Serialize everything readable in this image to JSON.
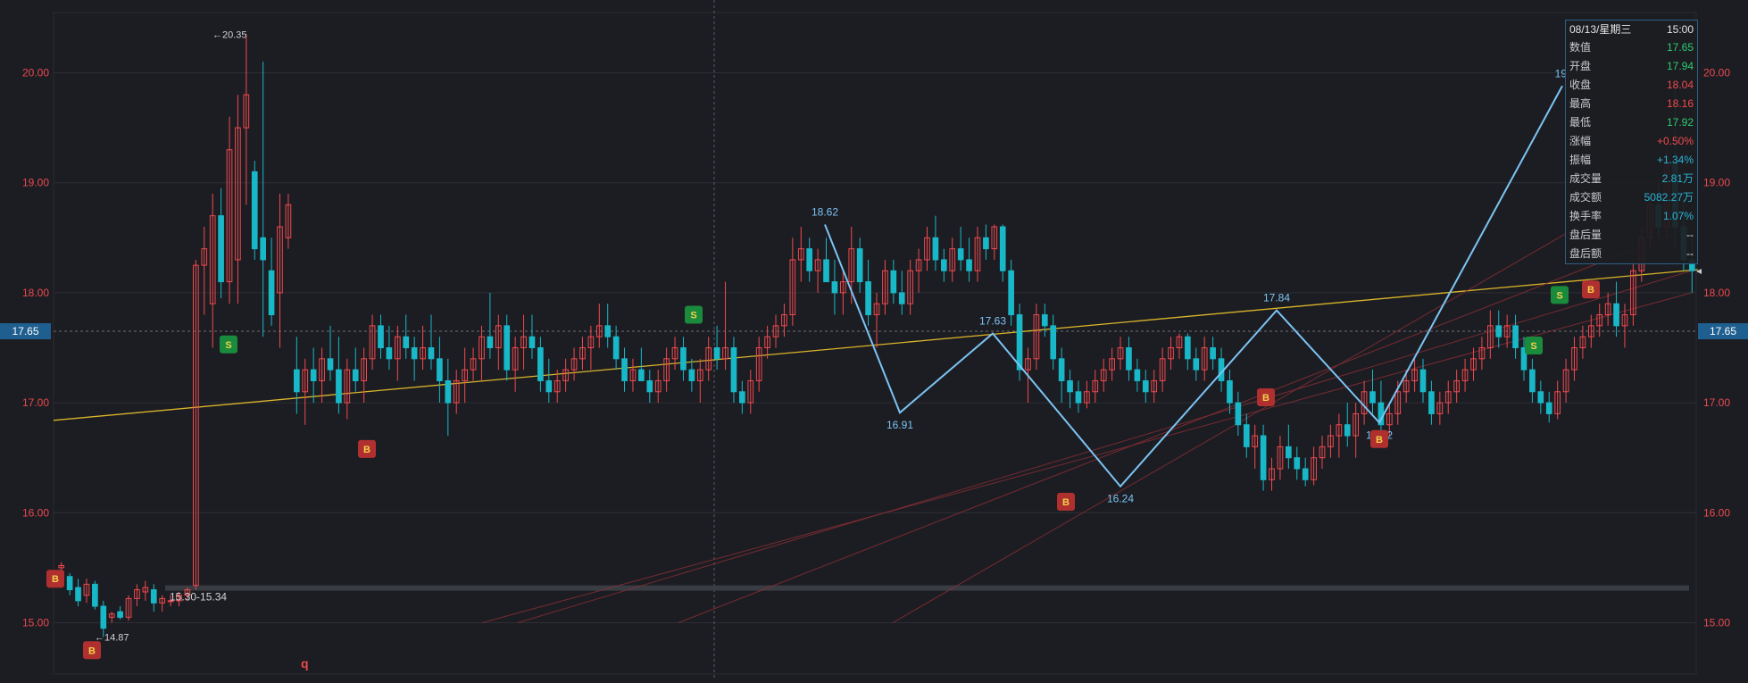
{
  "chart_data": {
    "type": "candlestick",
    "ylim": [
      14.9,
      20.55
    ],
    "y_ticks": [
      "15.00",
      "16.00",
      "17.00",
      "18.00",
      "19.00",
      "20.00"
    ],
    "current_price_label": "17.65",
    "candles": [
      [
        15.5,
        15.55,
        15.45,
        15.52
      ],
      [
        15.42,
        15.45,
        15.25,
        15.3
      ],
      [
        15.32,
        15.4,
        15.15,
        15.2
      ],
      [
        15.25,
        15.4,
        15.18,
        15.35
      ],
      [
        15.35,
        15.38,
        15.12,
        15.15
      ],
      [
        15.15,
        15.2,
        14.87,
        14.95
      ],
      [
        15.05,
        15.1,
        15.0,
        15.08
      ],
      [
        15.1,
        15.15,
        15.03,
        15.05
      ],
      [
        15.05,
        15.25,
        15.02,
        15.22
      ],
      [
        15.22,
        15.35,
        15.15,
        15.3
      ],
      [
        15.28,
        15.38,
        15.2,
        15.32
      ],
      [
        15.3,
        15.35,
        15.1,
        15.18
      ],
      [
        15.18,
        15.25,
        15.1,
        15.22
      ],
      [
        15.2,
        15.25,
        15.15,
        15.2
      ],
      [
        15.2,
        15.28,
        15.15,
        15.25
      ],
      [
        15.25,
        15.32,
        15.2,
        15.3
      ],
      [
        15.34,
        18.3,
        15.3,
        18.25
      ],
      [
        18.25,
        18.6,
        17.8,
        18.4
      ],
      [
        17.9,
        18.9,
        17.5,
        18.7
      ],
      [
        18.7,
        18.95,
        17.95,
        18.1
      ],
      [
        18.1,
        19.6,
        17.9,
        19.3
      ],
      [
        18.3,
        19.8,
        17.9,
        19.5
      ],
      [
        19.5,
        20.35,
        18.8,
        19.8
      ],
      [
        19.1,
        19.2,
        18.3,
        18.4
      ],
      [
        18.5,
        20.1,
        17.6,
        18.3
      ],
      [
        18.2,
        18.5,
        17.7,
        17.8
      ],
      [
        18.0,
        18.9,
        17.5,
        18.6
      ],
      [
        18.5,
        18.9,
        18.4,
        18.8
      ],
      [
        17.3,
        17.6,
        16.9,
        17.1
      ],
      [
        17.1,
        17.4,
        16.8,
        17.3
      ],
      [
        17.3,
        17.5,
        17.0,
        17.2
      ],
      [
        17.2,
        17.5,
        17.0,
        17.4
      ],
      [
        17.4,
        17.7,
        17.2,
        17.3
      ],
      [
        17.3,
        17.6,
        16.9,
        17.0
      ],
      [
        17.0,
        17.4,
        16.85,
        17.3
      ],
      [
        17.3,
        17.5,
        17.1,
        17.2
      ],
      [
        17.2,
        17.5,
        17.0,
        17.4
      ],
      [
        17.4,
        17.8,
        17.3,
        17.7
      ],
      [
        17.7,
        17.8,
        17.4,
        17.5
      ],
      [
        17.5,
        17.7,
        17.3,
        17.4
      ],
      [
        17.4,
        17.7,
        17.2,
        17.6
      ],
      [
        17.6,
        17.8,
        17.4,
        17.5
      ],
      [
        17.5,
        17.6,
        17.2,
        17.4
      ],
      [
        17.4,
        17.7,
        17.3,
        17.5
      ],
      [
        17.5,
        17.8,
        17.3,
        17.4
      ],
      [
        17.4,
        17.6,
        17.0,
        17.2
      ],
      [
        17.2,
        17.4,
        16.7,
        17.0
      ],
      [
        17.0,
        17.3,
        16.9,
        17.2
      ],
      [
        17.2,
        17.5,
        17.0,
        17.3
      ],
      [
        17.3,
        17.5,
        17.2,
        17.4
      ],
      [
        17.4,
        17.7,
        17.2,
        17.6
      ],
      [
        17.6,
        18.0,
        17.4,
        17.5
      ],
      [
        17.5,
        17.8,
        17.3,
        17.7
      ],
      [
        17.7,
        17.8,
        17.2,
        17.3
      ],
      [
        17.3,
        17.6,
        17.1,
        17.5
      ],
      [
        17.5,
        17.8,
        17.3,
        17.6
      ],
      [
        17.6,
        17.8,
        17.4,
        17.5
      ],
      [
        17.5,
        17.6,
        17.1,
        17.2
      ],
      [
        17.2,
        17.4,
        17.0,
        17.1
      ],
      [
        17.1,
        17.3,
        17.0,
        17.2
      ],
      [
        17.2,
        17.4,
        17.1,
        17.3
      ],
      [
        17.3,
        17.5,
        17.2,
        17.4
      ],
      [
        17.4,
        17.6,
        17.3,
        17.5
      ],
      [
        17.5,
        17.7,
        17.3,
        17.6
      ],
      [
        17.6,
        17.9,
        17.5,
        17.7
      ],
      [
        17.7,
        17.9,
        17.5,
        17.6
      ],
      [
        17.6,
        17.7,
        17.3,
        17.4
      ],
      [
        17.4,
        17.5,
        17.1,
        17.2
      ],
      [
        17.2,
        17.4,
        17.1,
        17.3
      ],
      [
        17.3,
        17.5,
        17.2,
        17.2
      ],
      [
        17.2,
        17.3,
        17.0,
        17.1
      ],
      [
        17.1,
        17.3,
        17.0,
        17.2
      ],
      [
        17.2,
        17.5,
        17.1,
        17.4
      ],
      [
        17.4,
        17.6,
        17.3,
        17.5
      ],
      [
        17.5,
        17.6,
        17.2,
        17.3
      ],
      [
        17.3,
        17.4,
        17.1,
        17.2
      ],
      [
        17.2,
        17.4,
        17.0,
        17.3
      ],
      [
        17.3,
        17.6,
        17.2,
        17.5
      ],
      [
        17.5,
        17.7,
        17.3,
        17.4
      ],
      [
        17.4,
        18.1,
        17.3,
        17.5
      ],
      [
        17.5,
        17.6,
        17.0,
        17.1
      ],
      [
        17.1,
        17.2,
        16.9,
        17.0
      ],
      [
        17.0,
        17.3,
        16.9,
        17.2
      ],
      [
        17.2,
        17.6,
        17.1,
        17.5
      ],
      [
        17.5,
        17.7,
        17.4,
        17.6
      ],
      [
        17.6,
        17.8,
        17.5,
        17.7
      ],
      [
        17.7,
        17.9,
        17.6,
        17.8
      ],
      [
        17.8,
        18.5,
        17.7,
        18.3
      ],
      [
        18.3,
        18.6,
        18.1,
        18.4
      ],
      [
        18.4,
        18.5,
        18.1,
        18.2
      ],
      [
        18.2,
        18.4,
        18.0,
        18.3
      ],
      [
        18.3,
        18.5,
        18.1,
        18.1
      ],
      [
        18.1,
        18.3,
        17.8,
        18.0
      ],
      [
        18.0,
        18.2,
        17.8,
        18.1
      ],
      [
        18.1,
        18.6,
        17.9,
        18.4
      ],
      [
        18.4,
        18.5,
        18.0,
        18.1
      ],
      [
        18.1,
        18.3,
        17.7,
        17.8
      ],
      [
        17.8,
        18.0,
        17.5,
        17.9
      ],
      [
        17.9,
        18.3,
        17.8,
        18.2
      ],
      [
        18.2,
        18.3,
        17.9,
        18.0
      ],
      [
        18.0,
        18.2,
        17.8,
        17.9
      ],
      [
        17.9,
        18.3,
        17.8,
        18.2
      ],
      [
        18.2,
        18.4,
        18.0,
        18.3
      ],
      [
        18.3,
        18.6,
        18.2,
        18.5
      ],
      [
        18.5,
        18.7,
        18.2,
        18.3
      ],
      [
        18.3,
        18.4,
        18.1,
        18.2
      ],
      [
        18.2,
        18.5,
        18.1,
        18.4
      ],
      [
        18.4,
        18.6,
        18.2,
        18.3
      ],
      [
        18.3,
        18.5,
        18.1,
        18.2
      ],
      [
        18.2,
        18.6,
        18.1,
        18.5
      ],
      [
        18.5,
        18.62,
        18.3,
        18.4
      ],
      [
        18.4,
        18.62,
        18.3,
        18.6
      ],
      [
        18.6,
        18.62,
        18.1,
        18.2
      ],
      [
        18.2,
        18.3,
        17.7,
        17.8
      ],
      [
        17.8,
        17.9,
        17.2,
        17.3
      ],
      [
        17.3,
        17.5,
        17.0,
        17.4
      ],
      [
        17.4,
        17.9,
        17.3,
        17.8
      ],
      [
        17.8,
        17.9,
        17.6,
        17.7
      ],
      [
        17.7,
        17.8,
        17.3,
        17.4
      ],
      [
        17.4,
        17.5,
        17.0,
        17.2
      ],
      [
        17.2,
        17.3,
        16.95,
        17.1
      ],
      [
        17.1,
        17.2,
        16.91,
        17.0
      ],
      [
        17.0,
        17.2,
        16.95,
        17.1
      ],
      [
        17.1,
        17.3,
        17.0,
        17.2
      ],
      [
        17.2,
        17.4,
        17.1,
        17.3
      ],
      [
        17.3,
        17.5,
        17.2,
        17.4
      ],
      [
        17.4,
        17.6,
        17.3,
        17.5
      ],
      [
        17.5,
        17.6,
        17.2,
        17.3
      ],
      [
        17.3,
        17.4,
        17.1,
        17.2
      ],
      [
        17.2,
        17.3,
        17.0,
        17.1
      ],
      [
        17.1,
        17.3,
        17.0,
        17.2
      ],
      [
        17.2,
        17.5,
        17.1,
        17.4
      ],
      [
        17.4,
        17.6,
        17.3,
        17.5
      ],
      [
        17.5,
        17.63,
        17.4,
        17.6
      ],
      [
        17.6,
        17.63,
        17.3,
        17.4
      ],
      [
        17.4,
        17.5,
        17.2,
        17.3
      ],
      [
        17.3,
        17.6,
        17.2,
        17.5
      ],
      [
        17.5,
        17.6,
        17.3,
        17.4
      ],
      [
        17.4,
        17.5,
        17.1,
        17.2
      ],
      [
        17.2,
        17.3,
        16.9,
        17.0
      ],
      [
        17.0,
        17.1,
        16.7,
        16.8
      ],
      [
        16.8,
        16.9,
        16.5,
        16.6
      ],
      [
        16.6,
        16.8,
        16.4,
        16.7
      ],
      [
        16.7,
        16.8,
        16.2,
        16.3
      ],
      [
        16.3,
        16.5,
        16.2,
        16.4
      ],
      [
        16.4,
        16.7,
        16.3,
        16.6
      ],
      [
        16.6,
        16.8,
        16.4,
        16.5
      ],
      [
        16.5,
        16.6,
        16.3,
        16.4
      ],
      [
        16.4,
        16.5,
        16.24,
        16.3
      ],
      [
        16.3,
        16.6,
        16.25,
        16.5
      ],
      [
        16.5,
        16.7,
        16.4,
        16.6
      ],
      [
        16.6,
        16.8,
        16.5,
        16.7
      ],
      [
        16.7,
        16.9,
        16.5,
        16.8
      ],
      [
        16.8,
        17.0,
        16.6,
        16.7
      ],
      [
        16.7,
        17.0,
        16.5,
        16.9
      ],
      [
        16.9,
        17.2,
        16.8,
        17.1
      ],
      [
        17.1,
        17.3,
        16.9,
        17.0
      ],
      [
        17.0,
        17.2,
        16.6,
        16.8
      ],
      [
        16.8,
        17.0,
        16.7,
        16.9
      ],
      [
        16.9,
        17.2,
        16.8,
        17.1
      ],
      [
        17.1,
        17.3,
        17.0,
        17.2
      ],
      [
        17.2,
        17.4,
        17.1,
        17.3
      ],
      [
        17.3,
        17.4,
        17.0,
        17.1
      ],
      [
        17.1,
        17.2,
        16.8,
        16.9
      ],
      [
        16.9,
        17.1,
        16.8,
        17.0
      ],
      [
        17.0,
        17.2,
        16.9,
        17.1
      ],
      [
        17.1,
        17.3,
        17.0,
        17.2
      ],
      [
        17.2,
        17.4,
        17.1,
        17.3
      ],
      [
        17.3,
        17.5,
        17.2,
        17.4
      ],
      [
        17.4,
        17.6,
        17.3,
        17.5
      ],
      [
        17.5,
        17.84,
        17.4,
        17.7
      ],
      [
        17.7,
        17.84,
        17.5,
        17.6
      ],
      [
        17.6,
        17.8,
        17.5,
        17.7
      ],
      [
        17.7,
        17.8,
        17.4,
        17.5
      ],
      [
        17.5,
        17.6,
        17.2,
        17.3
      ],
      [
        17.3,
        17.4,
        17.0,
        17.1
      ],
      [
        17.1,
        17.2,
        16.9,
        17.0
      ],
      [
        17.0,
        17.1,
        16.82,
        16.9
      ],
      [
        16.9,
        17.2,
        16.85,
        17.1
      ],
      [
        17.1,
        17.4,
        17.0,
        17.3
      ],
      [
        17.3,
        17.6,
        17.2,
        17.5
      ],
      [
        17.5,
        17.7,
        17.4,
        17.6
      ],
      [
        17.6,
        17.8,
        17.5,
        17.7
      ],
      [
        17.7,
        17.9,
        17.6,
        17.8
      ],
      [
        17.8,
        18.0,
        17.7,
        17.9
      ],
      [
        17.9,
        18.1,
        17.6,
        17.7
      ],
      [
        17.7,
        17.9,
        17.5,
        17.8
      ],
      [
        17.8,
        18.3,
        17.7,
        18.2
      ],
      [
        18.2,
        18.6,
        18.1,
        18.5
      ],
      [
        18.5,
        18.9,
        18.4,
        18.8
      ],
      [
        18.8,
        19.0,
        18.5,
        18.6
      ],
      [
        18.6,
        19.3,
        18.5,
        19.2
      ],
      [
        19.2,
        19.9,
        18.4,
        18.6
      ],
      [
        18.6,
        18.9,
        18.2,
        18.3
      ],
      [
        18.3,
        18.5,
        18.0,
        18.2
      ]
    ],
    "zigzag": [
      {
        "label": "18.62",
        "price": 18.62,
        "pos": "top"
      },
      {
        "label": "16.91",
        "price": 16.91,
        "pos": "bottom"
      },
      {
        "label": "17.63",
        "price": 17.63,
        "pos": "top"
      },
      {
        "label": "16.24",
        "price": 16.24,
        "pos": "bottom"
      },
      {
        "label": "17.84",
        "price": 17.84,
        "pos": "top"
      },
      {
        "label": "16.82",
        "price": 16.82,
        "pos": "bottom"
      },
      {
        "label": "19.",
        "price": 19.88,
        "pos": "top"
      }
    ],
    "annotations": {
      "high": "←20.35",
      "low": "←14.87",
      "range": "15.30-15.34",
      "cursor_marker": "q"
    },
    "signals": [
      {
        "type": "B",
        "price": 15.4
      },
      {
        "type": "B",
        "price": 14.75
      },
      {
        "type": "S",
        "price": 17.53
      },
      {
        "type": "B",
        "price": 16.58
      },
      {
        "type": "S",
        "price": 17.8
      },
      {
        "type": "B",
        "price": 16.1
      },
      {
        "type": "B",
        "price": 17.05
      },
      {
        "type": "B",
        "price": 16.67
      },
      {
        "type": "S",
        "price": 17.52
      },
      {
        "type": "S",
        "price": 17.98
      },
      {
        "type": "B",
        "price": 18.03
      }
    ]
  },
  "info_panel": {
    "date": "08/13/星期三",
    "time": "15:00",
    "rows": [
      {
        "label": "数值",
        "value": "17.65",
        "color": "green"
      },
      {
        "label": "开盘",
        "value": "17.94",
        "color": "green"
      },
      {
        "label": "收盘",
        "value": "18.04",
        "color": "red"
      },
      {
        "label": "最高",
        "value": "18.16",
        "color": "red"
      },
      {
        "label": "最低",
        "value": "17.92",
        "color": "green"
      },
      {
        "label": "涨幅",
        "value": "+0.50%",
        "color": "red"
      },
      {
        "label": "振幅",
        "value": "+1.34%",
        "color": "cyan"
      },
      {
        "label": "成交量",
        "value": "2.81万",
        "color": "cyan"
      },
      {
        "label": "成交额",
        "value": "5082.27万",
        "color": "cyan"
      },
      {
        "label": "换手率",
        "value": "1.07%",
        "color": "cyan"
      },
      {
        "label": "盘后量",
        "value": "--",
        "color": "white"
      },
      {
        "label": "盘后额",
        "value": "--",
        "color": "white"
      }
    ]
  },
  "colors": {
    "background": "#1c1d22",
    "up": "#f0494f",
    "down": "#19b8c8",
    "zigzag": "#7cc4f5",
    "trendline": "#d9b42a",
    "channel": "#8b2e36",
    "grid": "#2c2e35",
    "axis_text": "#e8494f",
    "signal_buy": "#b0302f",
    "signal_sell": "#1a8a3c"
  }
}
